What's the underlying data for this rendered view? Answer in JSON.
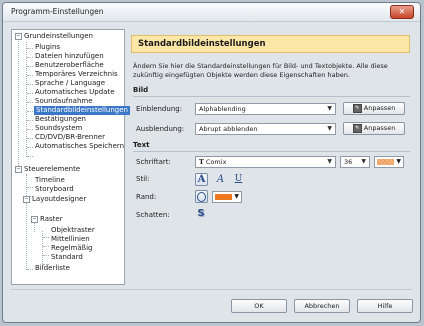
{
  "window": {
    "title": "Programm-Einstellungen"
  },
  "tree": {
    "items": [
      {
        "label": "Grundeinstellungen"
      },
      {
        "label": "Plugins"
      },
      {
        "label": "Dateien hinzufügen"
      },
      {
        "label": "Benutzeroberfläche"
      },
      {
        "label": "Temporäres Verzeichnis"
      },
      {
        "label": "Sprache / Language"
      },
      {
        "label": "Automatisches Update"
      },
      {
        "label": "Soundaufnahme"
      },
      {
        "label": "Standardbildeinstellungen"
      },
      {
        "label": "Bestätigungen"
      },
      {
        "label": "Soundsystem"
      },
      {
        "label": "CD/DVD/BR-Brenner"
      },
      {
        "label": "Automatisches Speichern"
      },
      {
        "label": "Steuerelemente"
      },
      {
        "label": "Timeline"
      },
      {
        "label": "Storyboard"
      },
      {
        "label": "Layoutdesigner"
      },
      {
        "label": "Raster"
      },
      {
        "label": "Objektraster"
      },
      {
        "label": "Mittellinien"
      },
      {
        "label": "Regelmäßig"
      },
      {
        "label": "Standard"
      },
      {
        "label": "Bilderliste"
      }
    ]
  },
  "panel": {
    "title": "Standardbildeinstellungen",
    "description": "Ändern Sie hier die Standardeinstellungen für Bild- und Textobjekte. Alle diese zukünftig eingefügten Objekte werden diese Eigenschaften haben.",
    "bild": {
      "heading": "Bild",
      "einblendung_label": "Einblendung:",
      "einblendung_value": "Alphablending",
      "ausblendung_label": "Ausblendung:",
      "ausblendung_value": "Abrupt abblenden",
      "anpassen_label": "Anpassen"
    },
    "text": {
      "heading": "Text",
      "schriftart_label": "Schriftart:",
      "font_value": "Comix",
      "font_size": "36",
      "font_color": "#f2b27a",
      "stil_label": "Stil:",
      "style_bold": "A",
      "style_italic": "A",
      "style_underline": "U",
      "rand_label": "Rand:",
      "rand_color": "#f0781e",
      "schatten_label": "Schatten:"
    }
  },
  "footer": {
    "ok": "OK",
    "cancel": "Abbrechen",
    "help": "Hilfe"
  }
}
